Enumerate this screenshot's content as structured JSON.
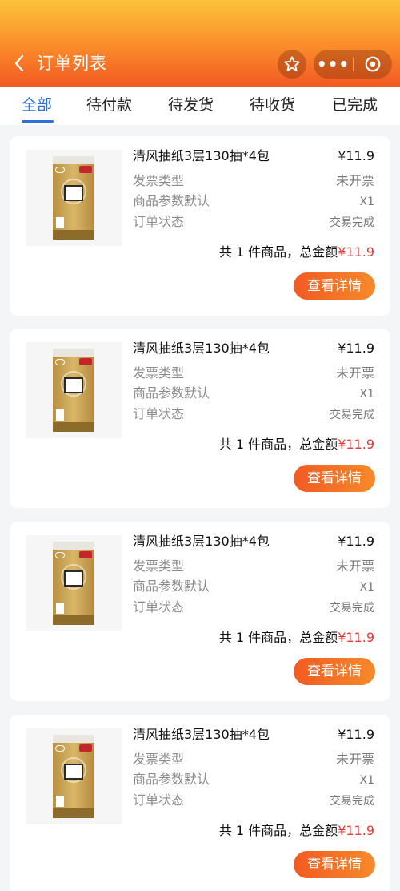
{
  "header": {
    "title": "订单列表",
    "back_icon": "chevron-left-icon",
    "favorite_icon": "star-icon",
    "more_icon": "more-dots-icon",
    "more_label": "•••",
    "close_icon": "target-close-icon",
    "gradient_colors": [
      "#fbc33a",
      "#f15a22"
    ]
  },
  "tabs": [
    {
      "label": "全部",
      "active": true
    },
    {
      "label": "待付款",
      "active": false
    },
    {
      "label": "待发货",
      "active": false
    },
    {
      "label": "待收货",
      "active": false
    },
    {
      "label": "已完成",
      "active": false
    }
  ],
  "accent_color": "#2f6fe0",
  "price_color": "#e53935",
  "orders": [
    {
      "product_name": "清风抽纸3层130抽*4包",
      "price": "¥11.9",
      "invoice_label": "发票类型",
      "invoice_value": "未开票",
      "param_label": "商品参数默认",
      "param_value": "X1",
      "status_label": "订单状态",
      "status_value": "交易完成",
      "summary_text": "共 1 件商品，总金额",
      "total": "¥11.9",
      "detail_button": "查看详情"
    },
    {
      "product_name": "清风抽纸3层130抽*4包",
      "price": "¥11.9",
      "invoice_label": "发票类型",
      "invoice_value": "未开票",
      "param_label": "商品参数默认",
      "param_value": "X1",
      "status_label": "订单状态",
      "status_value": "交易完成",
      "summary_text": "共 1 件商品，总金额",
      "total": "¥11.9",
      "detail_button": "查看详情"
    },
    {
      "product_name": "清风抽纸3层130抽*4包",
      "price": "¥11.9",
      "invoice_label": "发票类型",
      "invoice_value": "未开票",
      "param_label": "商品参数默认",
      "param_value": "X1",
      "status_label": "订单状态",
      "status_value": "交易完成",
      "summary_text": "共 1 件商品，总金额",
      "total": "¥11.9",
      "detail_button": "查看详情"
    },
    {
      "product_name": "清风抽纸3层130抽*4包",
      "price": "¥11.9",
      "invoice_label": "发票类型",
      "invoice_value": "未开票",
      "param_label": "商品参数默认",
      "param_value": "X1",
      "status_label": "订单状态",
      "status_value": "交易完成",
      "summary_text": "共 1 件商品，总金额",
      "total": "¥11.9",
      "detail_button": "查看详情"
    }
  ]
}
